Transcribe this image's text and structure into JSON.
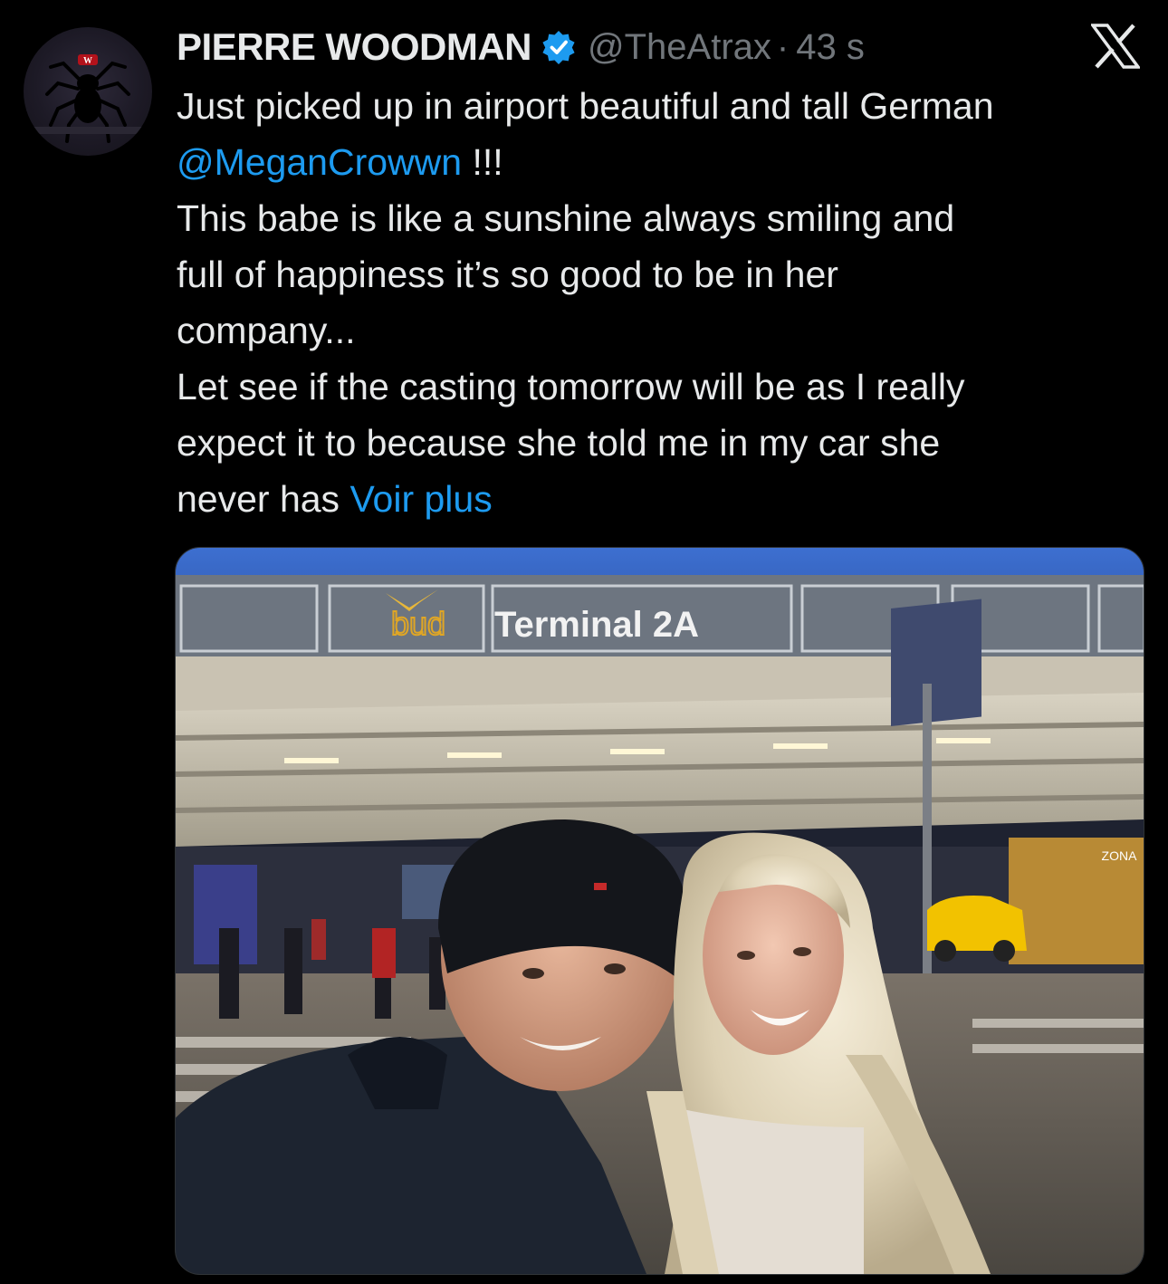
{
  "author": {
    "display_name": "PIERRE WOODMAN",
    "handle": "@TheAtrax",
    "separator": "·",
    "timestamp": "43 s",
    "verified": true,
    "avatar_icon": "spider-logo-icon"
  },
  "brand": {
    "logo_icon": "x-logo-icon"
  },
  "tweet": {
    "line1": "Just picked up in airport beautiful and tall German",
    "mention": "@MeganCrowwn",
    "mention_suffix": " !!!",
    "line3": "This babe is like a sunshine always smiling and",
    "line4": "full of happiness it’s so good to be in her",
    "line5": "company...",
    "line6": "Let see if the casting tomorrow will be as I really",
    "line7": "expect it to because she told me in my car she",
    "line8_prefix": "never has ",
    "show_more": "Voir plus"
  },
  "photo": {
    "sign_brand": "bud",
    "sign_text": "Terminal 2A",
    "right_sign_text": "ZONA"
  },
  "colors": {
    "background": "#000000",
    "text_primary": "#e7e9ea",
    "text_secondary": "#71767b",
    "link": "#1d9bf0",
    "verified": "#1d9bf0"
  }
}
